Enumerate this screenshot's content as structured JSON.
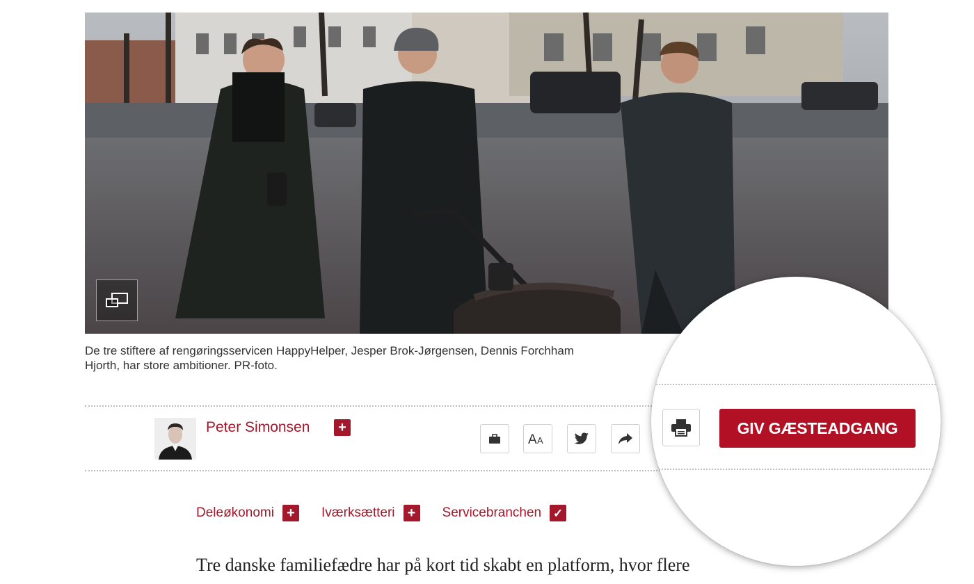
{
  "caption": "De tre stiftere af rengøringsservicen HappyHelper, Jesper Brok-Jørgensen, Dennis Forchham",
  "caption_line2": "Hjorth, har store ambitioner. PR-foto.",
  "author": {
    "name": "Peter Simonsen",
    "follow_label": "+"
  },
  "toolbar": {
    "icons": [
      "briefcase-icon",
      "text-size-icon",
      "twitter-icon",
      "share-icon",
      "print-icon"
    ],
    "guest_access_label": "GIV GÆSTEADGANG"
  },
  "tags": [
    {
      "label": "Deleøkonomi",
      "state": "+"
    },
    {
      "label": "Iværksætteri",
      "state": "+"
    },
    {
      "label": "Servicebranchen",
      "state": "✓"
    }
  ],
  "lead": "Tre danske familiefædre har på kort tid skabt en platform, hvor flere",
  "colors": {
    "accent": "#a3182a",
    "button": "#b11025"
  }
}
